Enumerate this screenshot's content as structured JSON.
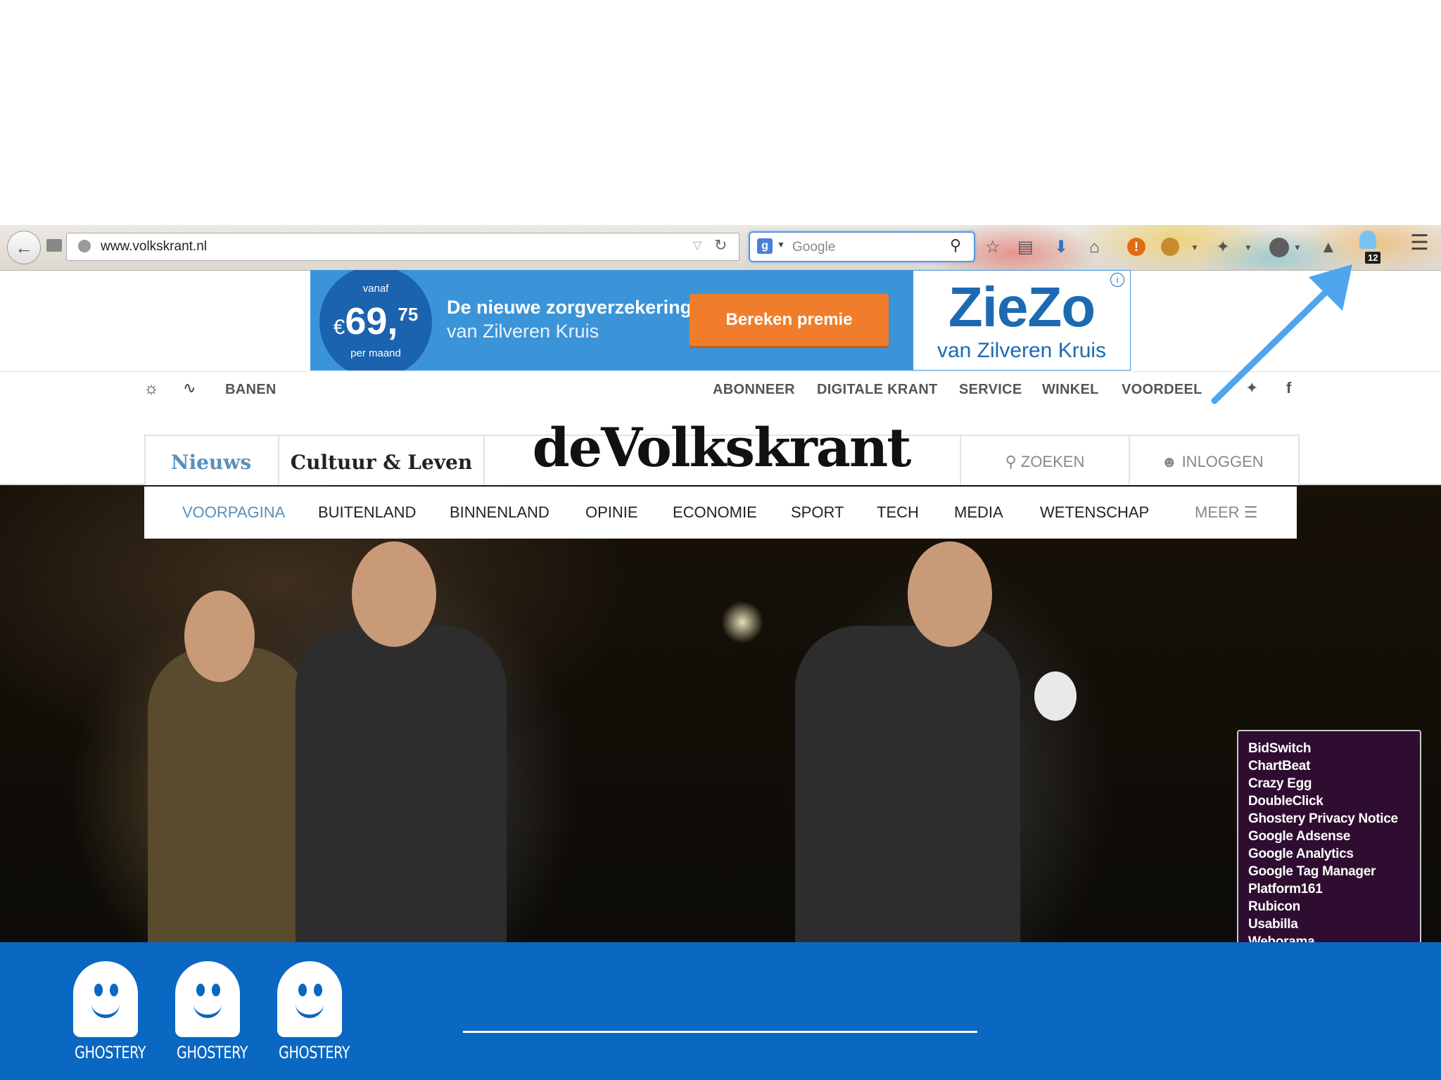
{
  "browser": {
    "url": "www.volkskrant.nl",
    "search_placeholder": "Google",
    "ghostery_tracker_count": "12"
  },
  "ad": {
    "from_label": "vanaf",
    "price_main": "69,",
    "price_cents": "75",
    "currency": "€",
    "per_month": "per maand",
    "headline_line1": "De nieuwe zorgverzekering",
    "headline_line2": "van Zilveren Kruis",
    "cta": "Bereken premie",
    "brand": "ZieZo",
    "brand_sub": "van Zilveren Kruis",
    "info": "i"
  },
  "site": {
    "top_left": [
      "BANEN"
    ],
    "top_right": [
      "ABONNEER",
      "DIGITALE KRANT",
      "SERVICE",
      "WINKEL",
      "VOORDEEL"
    ],
    "tab_news": "Nieuws",
    "tab_culture": "Cultuur & Leven",
    "logo": "deVolkskrant",
    "search": "ZOEKEN",
    "login": "INLOGGEN",
    "sections": [
      "VOORPAGINA",
      "BUITENLAND",
      "BINNENLAND",
      "OPINIE",
      "ECONOMIE",
      "SPORT",
      "TECH",
      "MEDIA",
      "WETENSCHAP"
    ],
    "more": "MEER"
  },
  "trackers": [
    "BidSwitch",
    "ChartBeat",
    "Crazy Egg",
    "DoubleClick",
    "Ghostery Privacy Notice",
    "Google Adsense",
    "Google Analytics",
    "Google Tag Manager",
    "Platform161",
    "Rubicon",
    "Usabilla",
    "Weborama"
  ],
  "ghostery_label": "GHOSTERY",
  "colors": {
    "ad_blue": "#3b94d8",
    "cta_orange": "#ef7d2b",
    "brand_blue": "#0a67c2",
    "section_active": "#5a8fb8",
    "tracker_bg": "#2f0d30",
    "arrow": "#4fa4ee"
  }
}
